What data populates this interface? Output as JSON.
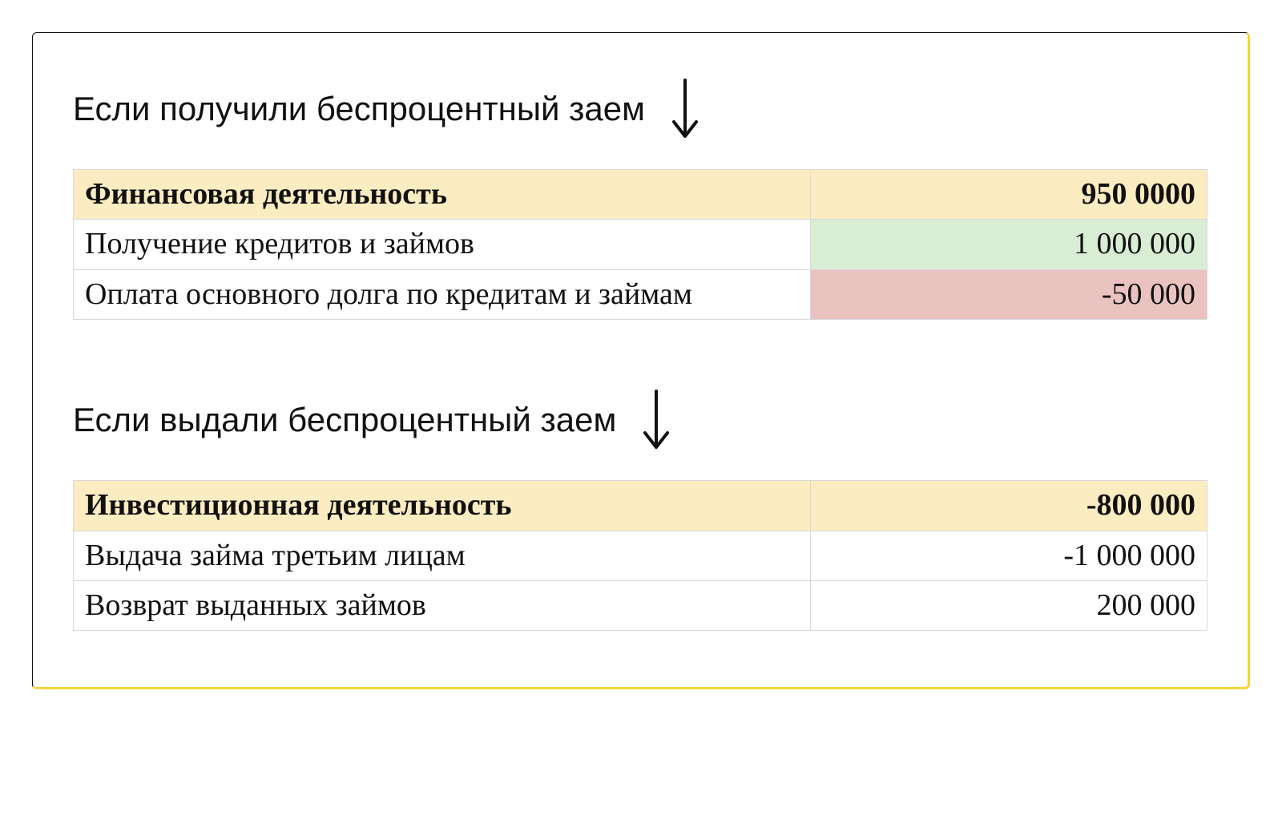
{
  "sections": [
    {
      "heading": "Если получили беспроцентный заем",
      "table": {
        "header": {
          "label": "Финансовая деятельность",
          "value": "950 0000"
        },
        "rows": [
          {
            "label": "Получение кредитов и займов",
            "value": "1 000 000",
            "value_class": "cell-green"
          },
          {
            "label": "Оплата основного долга по кредитам и займам",
            "value": "-50 000",
            "value_class": "cell-red"
          }
        ]
      }
    },
    {
      "heading": "Если выдали беспроцентный заем",
      "table": {
        "header": {
          "label": "Инвестиционная деятельность",
          "value": "-800 000"
        },
        "rows": [
          {
            "label": "Выдача займа третьим лицам",
            "value": "-1 000 000",
            "value_class": ""
          },
          {
            "label": "Возврат выданных займов",
            "value": "200 000",
            "value_class": ""
          }
        ]
      }
    }
  ],
  "chart_data": [
    {
      "type": "table",
      "title": "Финансовая деятельность",
      "total": 9500000,
      "rows": [
        {
          "label": "Получение кредитов и займов",
          "value": 1000000
        },
        {
          "label": "Оплата основного долга по кредитам и займам",
          "value": -50000
        }
      ]
    },
    {
      "type": "table",
      "title": "Инвестиционная деятельность",
      "total": -800000,
      "rows": [
        {
          "label": "Выдача займа третьим лицам",
          "value": -1000000
        },
        {
          "label": "Возврат выданных займов",
          "value": 200000
        }
      ]
    }
  ]
}
